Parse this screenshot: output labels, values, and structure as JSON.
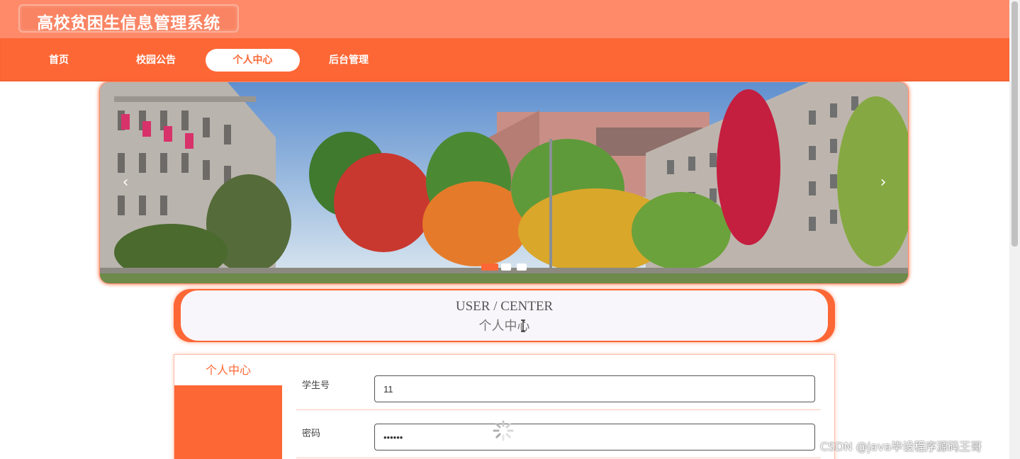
{
  "header": {
    "title": "高校贫困生信息管理系统"
  },
  "nav": {
    "items": [
      {
        "label": "首页"
      },
      {
        "label": "校园公告"
      },
      {
        "label": "个人中心"
      },
      {
        "label": "后台管理"
      }
    ],
    "active_index": 2
  },
  "banner": {
    "prev_glyph": "‹",
    "next_glyph": "›",
    "slides": 3,
    "active_slide": 0
  },
  "section": {
    "title_en": "USER / CENTER",
    "title_zh": "个人中心"
  },
  "sidebar": {
    "heading": "个人中心"
  },
  "form": {
    "fields": [
      {
        "label": "学生号",
        "value": "11",
        "type": "text"
      },
      {
        "label": "密码",
        "value": "••••••",
        "type": "password"
      }
    ]
  },
  "watermark": "CSDN @java毕设程序源码王哥",
  "colors": {
    "primary": "#fd6735",
    "header": "#fe8a6a",
    "panel_bg": "#f8f6fa"
  }
}
